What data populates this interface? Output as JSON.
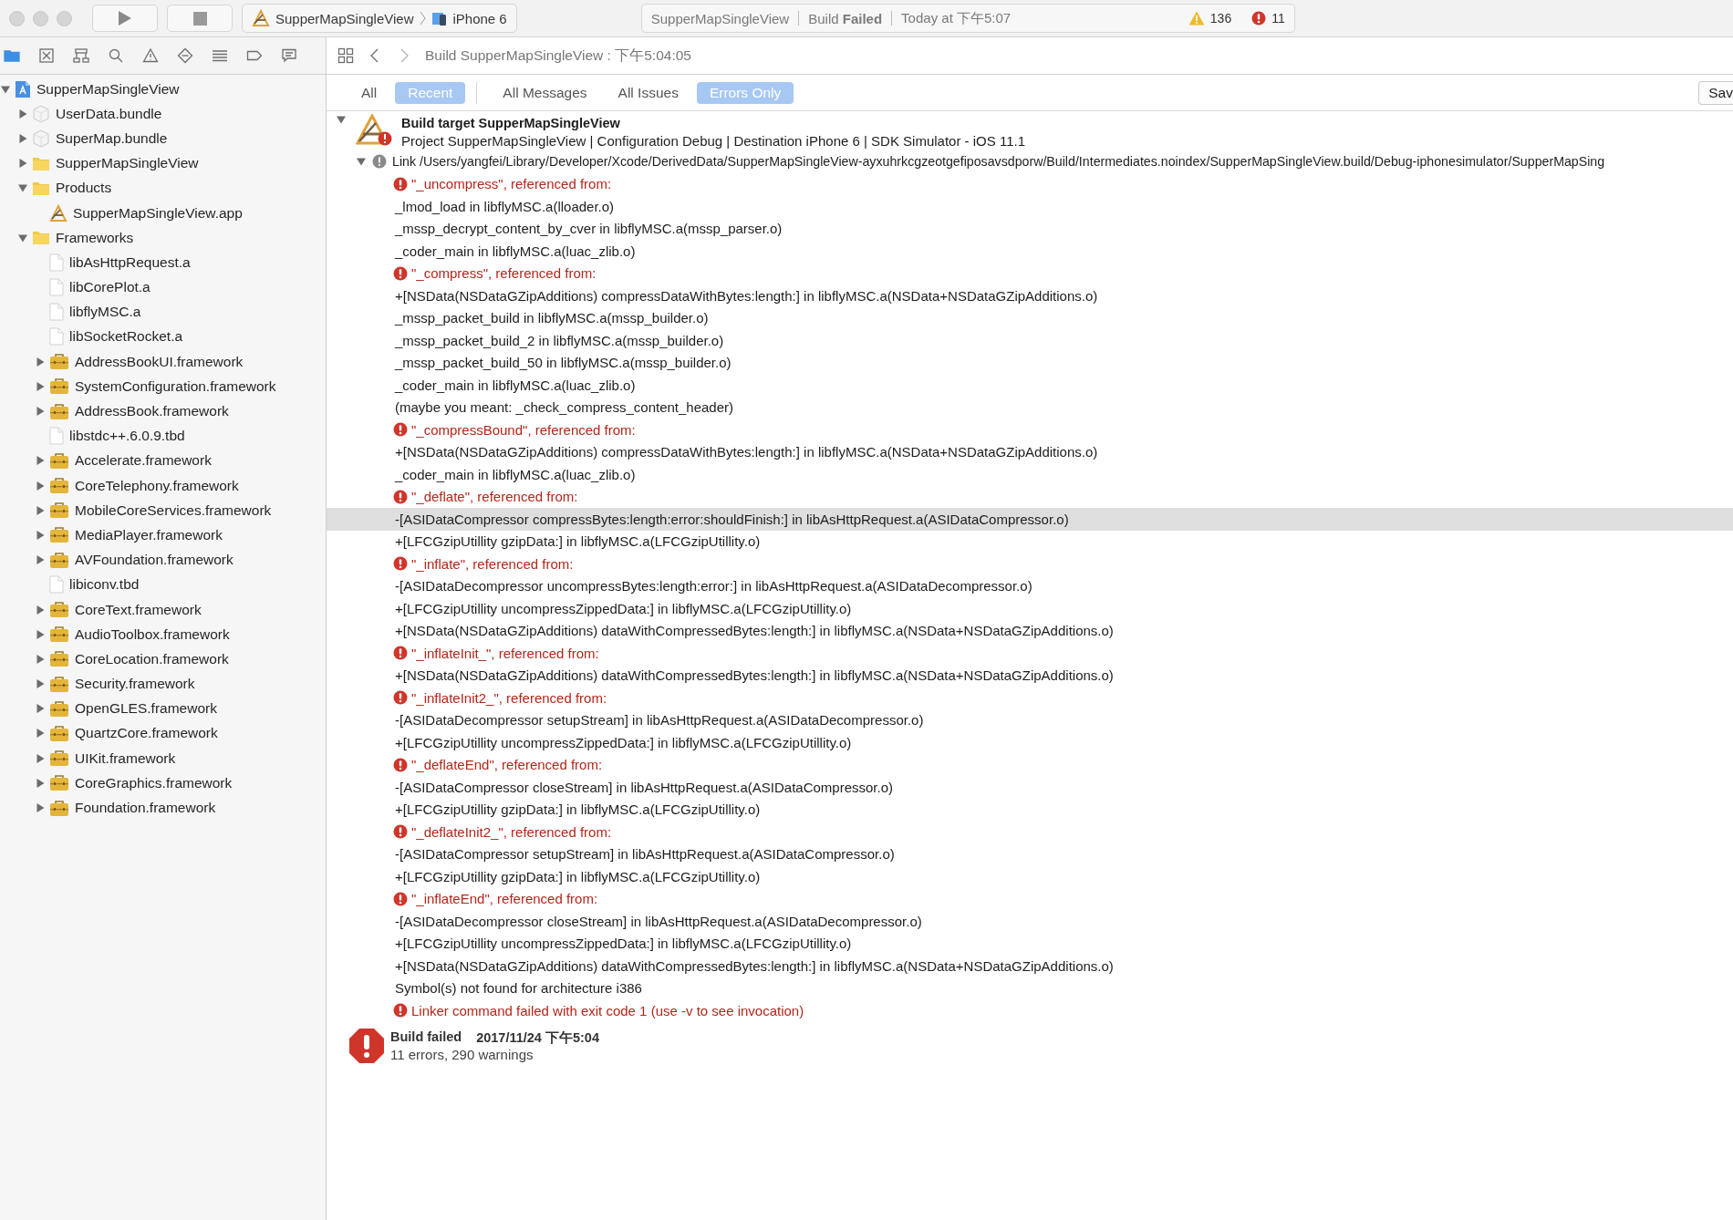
{
  "toolbar": {
    "scheme": {
      "target": "SupperMapSingleView",
      "device": "iPhone 6"
    },
    "status": {
      "project": "SupperMapSingleView",
      "build_label": "Build",
      "build_result": "Failed",
      "time": "Today at 下午5:07",
      "warnings": "136",
      "errors": "11"
    }
  },
  "jump_bar": {
    "path": "Build SupperMapSingleView : 下午5:04:05"
  },
  "filter_bar": {
    "scope_tabs": [
      {
        "label": "All",
        "selected": false
      },
      {
        "label": "Recent",
        "selected": true
      }
    ],
    "type_tabs": [
      {
        "label": "All Messages",
        "selected": false
      },
      {
        "label": "All Issues",
        "selected": false
      },
      {
        "label": "Errors Only",
        "selected": true
      }
    ],
    "save_button": "Sav"
  },
  "navigator": {
    "items": [
      {
        "label": "SupperMapSingleView",
        "kind": "project",
        "expanded": true,
        "children": [
          {
            "label": "UserData.bundle",
            "kind": "bundle",
            "expanded": false
          },
          {
            "label": "SuperMap.bundle",
            "kind": "bundle",
            "expanded": false
          },
          {
            "label": "SupperMapSingleView",
            "kind": "folder",
            "expanded": false
          },
          {
            "label": "Products",
            "kind": "folder",
            "expanded": true,
            "children": [
              {
                "label": "SupperMapSingleView.app",
                "kind": "app"
              }
            ]
          },
          {
            "label": "Frameworks",
            "kind": "folder",
            "expanded": true,
            "children": [
              {
                "label": "libAsHttpRequest.a",
                "kind": "file"
              },
              {
                "label": "libCorePlot.a",
                "kind": "file"
              },
              {
                "label": "libflyMSC.a",
                "kind": "file"
              },
              {
                "label": "libSocketRocket.a",
                "kind": "file"
              },
              {
                "label": "AddressBookUI.framework",
                "kind": "framework",
                "expanded": false
              },
              {
                "label": "SystemConfiguration.framework",
                "kind": "framework",
                "expanded": false
              },
              {
                "label": "AddressBook.framework",
                "kind": "framework",
                "expanded": false
              },
              {
                "label": "libstdc++.6.0.9.tbd",
                "kind": "file"
              },
              {
                "label": "Accelerate.framework",
                "kind": "framework",
                "expanded": false
              },
              {
                "label": "CoreTelephony.framework",
                "kind": "framework",
                "expanded": false
              },
              {
                "label": "MobileCoreServices.framework",
                "kind": "framework",
                "expanded": false
              },
              {
                "label": "MediaPlayer.framework",
                "kind": "framework",
                "expanded": false
              },
              {
                "label": "AVFoundation.framework",
                "kind": "framework",
                "expanded": false
              },
              {
                "label": "libiconv.tbd",
                "kind": "file"
              },
              {
                "label": "CoreText.framework",
                "kind": "framework",
                "expanded": false
              },
              {
                "label": "AudioToolbox.framework",
                "kind": "framework",
                "expanded": false
              },
              {
                "label": "CoreLocation.framework",
                "kind": "framework",
                "expanded": false
              },
              {
                "label": "Security.framework",
                "kind": "framework",
                "expanded": false
              },
              {
                "label": "OpenGLES.framework",
                "kind": "framework",
                "expanded": false
              },
              {
                "label": "QuartzCore.framework",
                "kind": "framework",
                "expanded": false
              },
              {
                "label": "UIKit.framework",
                "kind": "framework",
                "expanded": false
              },
              {
                "label": "CoreGraphics.framework",
                "kind": "framework",
                "expanded": false
              },
              {
                "label": "Foundation.framework",
                "kind": "framework",
                "expanded": false
              }
            ]
          }
        ]
      }
    ]
  },
  "build_log": {
    "target": {
      "title": "Build target SupperMapSingleView",
      "detail": "Project SupperMapSingleView | Configuration Debug | Destination iPhone 6 | SDK Simulator - iOS 11.1",
      "expanded": true
    },
    "link": {
      "text": "Link /Users/yangfei/Library/Developer/Xcode/DerivedData/SupperMapSingleView-ayxuhrkcgzeotgefiposavsdporw/Build/Intermediates.noindex/SupperMapSingleView.build/Debug-iphonesimulator/SupperMapSing",
      "expanded": true
    },
    "lines": [
      {
        "kind": "error",
        "text": "\"_uncompress\", referenced from:",
        "selected": false
      },
      {
        "kind": "detail",
        "text": "_lmod_load in libflyMSC.a(lloader.o)",
        "selected": false
      },
      {
        "kind": "detail",
        "text": "_mssp_decrypt_content_by_cver in libflyMSC.a(mssp_parser.o)",
        "selected": false
      },
      {
        "kind": "detail",
        "text": "_coder_main in libflyMSC.a(luac_zlib.o)",
        "selected": false
      },
      {
        "kind": "error",
        "text": "\"_compress\", referenced from:",
        "selected": false
      },
      {
        "kind": "detail",
        "text": "+[NSData(NSDataGZipAdditions) compressDataWithBytes:length:] in libflyMSC.a(NSData+NSDataGZipAdditions.o)",
        "selected": false
      },
      {
        "kind": "detail",
        "text": "_mssp_packet_build in libflyMSC.a(mssp_builder.o)",
        "selected": false
      },
      {
        "kind": "detail",
        "text": "_mssp_packet_build_2 in libflyMSC.a(mssp_builder.o)",
        "selected": false
      },
      {
        "kind": "detail",
        "text": "_mssp_packet_build_50 in libflyMSC.a(mssp_builder.o)",
        "selected": false
      },
      {
        "kind": "detail",
        "text": "_coder_main in libflyMSC.a(luac_zlib.o)",
        "selected": false
      },
      {
        "kind": "detail",
        "text": "(maybe you meant: _check_compress_content_header)",
        "selected": false
      },
      {
        "kind": "error",
        "text": "\"_compressBound\", referenced from:",
        "selected": false
      },
      {
        "kind": "detail",
        "text": "+[NSData(NSDataGZipAdditions) compressDataWithBytes:length:] in libflyMSC.a(NSData+NSDataGZipAdditions.o)",
        "selected": false
      },
      {
        "kind": "detail",
        "text": "_coder_main in libflyMSC.a(luac_zlib.o)",
        "selected": false
      },
      {
        "kind": "error",
        "text": "\"_deflate\", referenced from:",
        "selected": false
      },
      {
        "kind": "detail",
        "text": "-[ASIDataCompressor compressBytes:length:error:shouldFinish:] in libAsHttpRequest.a(ASIDataCompressor.o)",
        "selected": true
      },
      {
        "kind": "detail",
        "text": "+[LFCGzipUtillity gzipData:] in libflyMSC.a(LFCGzipUtillity.o)",
        "selected": false
      },
      {
        "kind": "error",
        "text": "\"_inflate\", referenced from:",
        "selected": false
      },
      {
        "kind": "detail",
        "text": "-[ASIDataDecompressor uncompressBytes:length:error:] in libAsHttpRequest.a(ASIDataDecompressor.o)",
        "selected": false
      },
      {
        "kind": "detail",
        "text": "+[LFCGzipUtillity uncompressZippedData:] in libflyMSC.a(LFCGzipUtillity.o)",
        "selected": false
      },
      {
        "kind": "detail",
        "text": "+[NSData(NSDataGZipAdditions) dataWithCompressedBytes:length:] in libflyMSC.a(NSData+NSDataGZipAdditions.o)",
        "selected": false
      },
      {
        "kind": "error",
        "text": "\"_inflateInit_\", referenced from:",
        "selected": false
      },
      {
        "kind": "detail",
        "text": "+[NSData(NSDataGZipAdditions) dataWithCompressedBytes:length:] in libflyMSC.a(NSData+NSDataGZipAdditions.o)",
        "selected": false
      },
      {
        "kind": "error",
        "text": "\"_inflateInit2_\", referenced from:",
        "selected": false
      },
      {
        "kind": "detail",
        "text": "-[ASIDataDecompressor setupStream] in libAsHttpRequest.a(ASIDataDecompressor.o)",
        "selected": false
      },
      {
        "kind": "detail",
        "text": "+[LFCGzipUtillity uncompressZippedData:] in libflyMSC.a(LFCGzipUtillity.o)",
        "selected": false
      },
      {
        "kind": "error",
        "text": "\"_deflateEnd\", referenced from:",
        "selected": false
      },
      {
        "kind": "detail",
        "text": "-[ASIDataCompressor closeStream] in libAsHttpRequest.a(ASIDataCompressor.o)",
        "selected": false
      },
      {
        "kind": "detail",
        "text": "+[LFCGzipUtillity gzipData:] in libflyMSC.a(LFCGzipUtillity.o)",
        "selected": false
      },
      {
        "kind": "error",
        "text": "\"_deflateInit2_\", referenced from:",
        "selected": false
      },
      {
        "kind": "detail",
        "text": "-[ASIDataCompressor setupStream] in libAsHttpRequest.a(ASIDataCompressor.o)",
        "selected": false
      },
      {
        "kind": "detail",
        "text": "+[LFCGzipUtillity gzipData:] in libflyMSC.a(LFCGzipUtillity.o)",
        "selected": false
      },
      {
        "kind": "error",
        "text": "\"_inflateEnd\", referenced from:",
        "selected": false
      },
      {
        "kind": "detail",
        "text": "-[ASIDataDecompressor closeStream] in libAsHttpRequest.a(ASIDataDecompressor.o)",
        "selected": false
      },
      {
        "kind": "detail",
        "text": "+[LFCGzipUtillity uncompressZippedData:] in libflyMSC.a(LFCGzipUtillity.o)",
        "selected": false
      },
      {
        "kind": "detail",
        "text": "+[NSData(NSDataGZipAdditions) dataWithCompressedBytes:length:] in libflyMSC.a(NSData+NSDataGZipAdditions.o)",
        "selected": false
      },
      {
        "kind": "detail",
        "text": "Symbol(s) not found for architecture i386",
        "selected": false
      },
      {
        "kind": "error",
        "text": "Linker command failed with exit code 1 (use -v to see invocation)",
        "selected": false
      }
    ],
    "result": {
      "title": "Build failed",
      "date": "2017/11/24 下午5:04",
      "summary": "11 errors, 290 warnings"
    }
  }
}
